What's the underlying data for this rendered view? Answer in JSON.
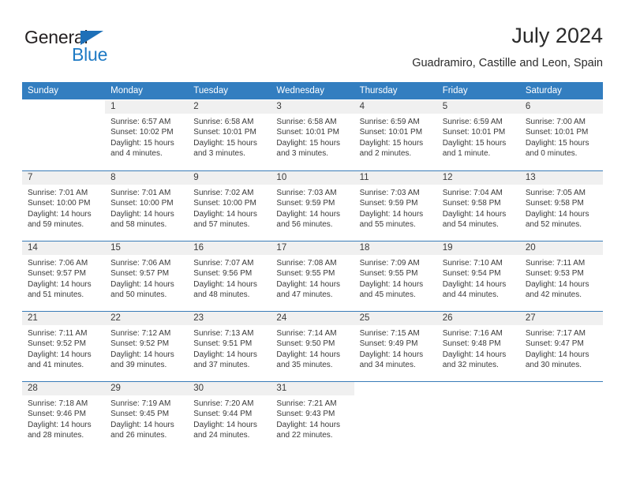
{
  "brand": {
    "name_part1": "General",
    "name_part2": "Blue",
    "triangle_color": "#1e70b8",
    "blue_color": "#1e7ac4",
    "dark_color": "#231f20"
  },
  "header": {
    "title": "July 2024",
    "subtitle": "Guadramiro, Castille and Leon, Spain"
  },
  "theme": {
    "header_bg": "#337ec0",
    "daynum_bg": "#f0f0f0",
    "row_divider": "#3a7cb8",
    "text": "#3a3a3a"
  },
  "weekdays": [
    "Sunday",
    "Monday",
    "Tuesday",
    "Wednesday",
    "Thursday",
    "Friday",
    "Saturday"
  ],
  "weeks": [
    [
      {
        "day": "",
        "sunrise": "",
        "sunset": "",
        "daylight_line1": "",
        "daylight_line2": ""
      },
      {
        "day": "1",
        "sunrise": "Sunrise: 6:57 AM",
        "sunset": "Sunset: 10:02 PM",
        "daylight_line1": "Daylight: 15 hours",
        "daylight_line2": "and 4 minutes."
      },
      {
        "day": "2",
        "sunrise": "Sunrise: 6:58 AM",
        "sunset": "Sunset: 10:01 PM",
        "daylight_line1": "Daylight: 15 hours",
        "daylight_line2": "and 3 minutes."
      },
      {
        "day": "3",
        "sunrise": "Sunrise: 6:58 AM",
        "sunset": "Sunset: 10:01 PM",
        "daylight_line1": "Daylight: 15 hours",
        "daylight_line2": "and 3 minutes."
      },
      {
        "day": "4",
        "sunrise": "Sunrise: 6:59 AM",
        "sunset": "Sunset: 10:01 PM",
        "daylight_line1": "Daylight: 15 hours",
        "daylight_line2": "and 2 minutes."
      },
      {
        "day": "5",
        "sunrise": "Sunrise: 6:59 AM",
        "sunset": "Sunset: 10:01 PM",
        "daylight_line1": "Daylight: 15 hours",
        "daylight_line2": "and 1 minute."
      },
      {
        "day": "6",
        "sunrise": "Sunrise: 7:00 AM",
        "sunset": "Sunset: 10:01 PM",
        "daylight_line1": "Daylight: 15 hours",
        "daylight_line2": "and 0 minutes."
      }
    ],
    [
      {
        "day": "7",
        "sunrise": "Sunrise: 7:01 AM",
        "sunset": "Sunset: 10:00 PM",
        "daylight_line1": "Daylight: 14 hours",
        "daylight_line2": "and 59 minutes."
      },
      {
        "day": "8",
        "sunrise": "Sunrise: 7:01 AM",
        "sunset": "Sunset: 10:00 PM",
        "daylight_line1": "Daylight: 14 hours",
        "daylight_line2": "and 58 minutes."
      },
      {
        "day": "9",
        "sunrise": "Sunrise: 7:02 AM",
        "sunset": "Sunset: 10:00 PM",
        "daylight_line1": "Daylight: 14 hours",
        "daylight_line2": "and 57 minutes."
      },
      {
        "day": "10",
        "sunrise": "Sunrise: 7:03 AM",
        "sunset": "Sunset: 9:59 PM",
        "daylight_line1": "Daylight: 14 hours",
        "daylight_line2": "and 56 minutes."
      },
      {
        "day": "11",
        "sunrise": "Sunrise: 7:03 AM",
        "sunset": "Sunset: 9:59 PM",
        "daylight_line1": "Daylight: 14 hours",
        "daylight_line2": "and 55 minutes."
      },
      {
        "day": "12",
        "sunrise": "Sunrise: 7:04 AM",
        "sunset": "Sunset: 9:58 PM",
        "daylight_line1": "Daylight: 14 hours",
        "daylight_line2": "and 54 minutes."
      },
      {
        "day": "13",
        "sunrise": "Sunrise: 7:05 AM",
        "sunset": "Sunset: 9:58 PM",
        "daylight_line1": "Daylight: 14 hours",
        "daylight_line2": "and 52 minutes."
      }
    ],
    [
      {
        "day": "14",
        "sunrise": "Sunrise: 7:06 AM",
        "sunset": "Sunset: 9:57 PM",
        "daylight_line1": "Daylight: 14 hours",
        "daylight_line2": "and 51 minutes."
      },
      {
        "day": "15",
        "sunrise": "Sunrise: 7:06 AM",
        "sunset": "Sunset: 9:57 PM",
        "daylight_line1": "Daylight: 14 hours",
        "daylight_line2": "and 50 minutes."
      },
      {
        "day": "16",
        "sunrise": "Sunrise: 7:07 AM",
        "sunset": "Sunset: 9:56 PM",
        "daylight_line1": "Daylight: 14 hours",
        "daylight_line2": "and 48 minutes."
      },
      {
        "day": "17",
        "sunrise": "Sunrise: 7:08 AM",
        "sunset": "Sunset: 9:55 PM",
        "daylight_line1": "Daylight: 14 hours",
        "daylight_line2": "and 47 minutes."
      },
      {
        "day": "18",
        "sunrise": "Sunrise: 7:09 AM",
        "sunset": "Sunset: 9:55 PM",
        "daylight_line1": "Daylight: 14 hours",
        "daylight_line2": "and 45 minutes."
      },
      {
        "day": "19",
        "sunrise": "Sunrise: 7:10 AM",
        "sunset": "Sunset: 9:54 PM",
        "daylight_line1": "Daylight: 14 hours",
        "daylight_line2": "and 44 minutes."
      },
      {
        "day": "20",
        "sunrise": "Sunrise: 7:11 AM",
        "sunset": "Sunset: 9:53 PM",
        "daylight_line1": "Daylight: 14 hours",
        "daylight_line2": "and 42 minutes."
      }
    ],
    [
      {
        "day": "21",
        "sunrise": "Sunrise: 7:11 AM",
        "sunset": "Sunset: 9:52 PM",
        "daylight_line1": "Daylight: 14 hours",
        "daylight_line2": "and 41 minutes."
      },
      {
        "day": "22",
        "sunrise": "Sunrise: 7:12 AM",
        "sunset": "Sunset: 9:52 PM",
        "daylight_line1": "Daylight: 14 hours",
        "daylight_line2": "and 39 minutes."
      },
      {
        "day": "23",
        "sunrise": "Sunrise: 7:13 AM",
        "sunset": "Sunset: 9:51 PM",
        "daylight_line1": "Daylight: 14 hours",
        "daylight_line2": "and 37 minutes."
      },
      {
        "day": "24",
        "sunrise": "Sunrise: 7:14 AM",
        "sunset": "Sunset: 9:50 PM",
        "daylight_line1": "Daylight: 14 hours",
        "daylight_line2": "and 35 minutes."
      },
      {
        "day": "25",
        "sunrise": "Sunrise: 7:15 AM",
        "sunset": "Sunset: 9:49 PM",
        "daylight_line1": "Daylight: 14 hours",
        "daylight_line2": "and 34 minutes."
      },
      {
        "day": "26",
        "sunrise": "Sunrise: 7:16 AM",
        "sunset": "Sunset: 9:48 PM",
        "daylight_line1": "Daylight: 14 hours",
        "daylight_line2": "and 32 minutes."
      },
      {
        "day": "27",
        "sunrise": "Sunrise: 7:17 AM",
        "sunset": "Sunset: 9:47 PM",
        "daylight_line1": "Daylight: 14 hours",
        "daylight_line2": "and 30 minutes."
      }
    ],
    [
      {
        "day": "28",
        "sunrise": "Sunrise: 7:18 AM",
        "sunset": "Sunset: 9:46 PM",
        "daylight_line1": "Daylight: 14 hours",
        "daylight_line2": "and 28 minutes."
      },
      {
        "day": "29",
        "sunrise": "Sunrise: 7:19 AM",
        "sunset": "Sunset: 9:45 PM",
        "daylight_line1": "Daylight: 14 hours",
        "daylight_line2": "and 26 minutes."
      },
      {
        "day": "30",
        "sunrise": "Sunrise: 7:20 AM",
        "sunset": "Sunset: 9:44 PM",
        "daylight_line1": "Daylight: 14 hours",
        "daylight_line2": "and 24 minutes."
      },
      {
        "day": "31",
        "sunrise": "Sunrise: 7:21 AM",
        "sunset": "Sunset: 9:43 PM",
        "daylight_line1": "Daylight: 14 hours",
        "daylight_line2": "and 22 minutes."
      },
      {
        "day": "",
        "sunrise": "",
        "sunset": "",
        "daylight_line1": "",
        "daylight_line2": ""
      },
      {
        "day": "",
        "sunrise": "",
        "sunset": "",
        "daylight_line1": "",
        "daylight_line2": ""
      },
      {
        "day": "",
        "sunrise": "",
        "sunset": "",
        "daylight_line1": "",
        "daylight_line2": ""
      }
    ]
  ]
}
